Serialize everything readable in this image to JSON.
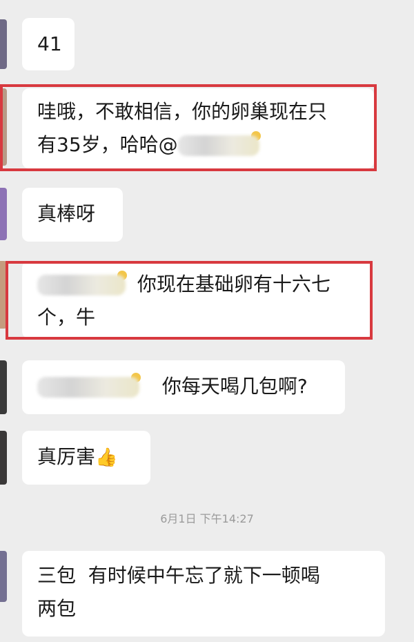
{
  "messages": [
    {
      "id": "m1",
      "text": "41"
    },
    {
      "id": "m2",
      "line1": "哇哦，不敢相信，你的卵巢现在只",
      "line2_prefix": "有35岁，哈哈@"
    },
    {
      "id": "m3",
      "text": "真棒呀"
    },
    {
      "id": "m4",
      "line1_suffix": "你现在基础卵有十六七",
      "line2": "个，牛"
    },
    {
      "id": "m5",
      "suffix": "你每天喝几包啊?"
    },
    {
      "id": "m6",
      "text": "真厉害",
      "emoji": "thumbs-up-icon"
    },
    {
      "id": "m8",
      "line1": "三包  有时候中午忘了就下一顿喝",
      "line2": "两包"
    }
  ],
  "timestamp": "6月1日  下午14:27",
  "colors": {
    "highlight": "#d8393f",
    "background": "#ededed",
    "bubble": "#ffffff"
  }
}
